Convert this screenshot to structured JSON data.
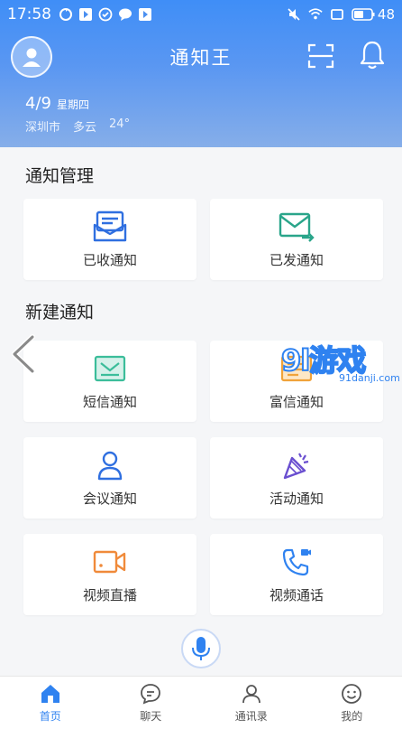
{
  "status_bar": {
    "time": "17:58",
    "battery": "48"
  },
  "header": {
    "title": "通知王",
    "date": "4/9",
    "weekday": "星期四",
    "city": "深圳市",
    "weather": "多云",
    "temperature": "24°"
  },
  "sections": {
    "manage_title": "通知管理",
    "create_title": "新建通知"
  },
  "manage_items": [
    {
      "label": "已收通知",
      "icon": "inbox-mail-icon",
      "color": "#2f6fe0"
    },
    {
      "label": "已发通知",
      "icon": "sent-mail-icon",
      "color": "#2aa58a"
    }
  ],
  "create_items": [
    {
      "label": "短信通知",
      "icon": "sms-icon",
      "color": "#3bbd9a"
    },
    {
      "label": "富信通知",
      "icon": "rich-message-icon",
      "color": "#f0a33a"
    },
    {
      "label": "会议通知",
      "icon": "meeting-person-icon",
      "color": "#2f6fe0"
    },
    {
      "label": "活动通知",
      "icon": "party-popper-icon",
      "color": "#6a4fd0"
    },
    {
      "label": "视频直播",
      "icon": "video-camera-icon",
      "color": "#f08a3a"
    },
    {
      "label": "视频通话",
      "icon": "video-call-phone-icon",
      "color": "#2f82f0"
    }
  ],
  "watermark": {
    "logo": "9l游戏",
    "url": "91danji.com"
  },
  "tabs": [
    {
      "label": "首页",
      "icon": "home-icon",
      "active": true
    },
    {
      "label": "聊天",
      "icon": "chat-bubble-icon",
      "active": false
    },
    {
      "label": "通讯录",
      "icon": "contacts-icon",
      "active": false
    },
    {
      "label": "我的",
      "icon": "smiley-face-icon",
      "active": false
    }
  ],
  "colors": {
    "accent": "#2f82f0",
    "header_top": "#3f8ef7",
    "background": "#f5f6f8"
  }
}
